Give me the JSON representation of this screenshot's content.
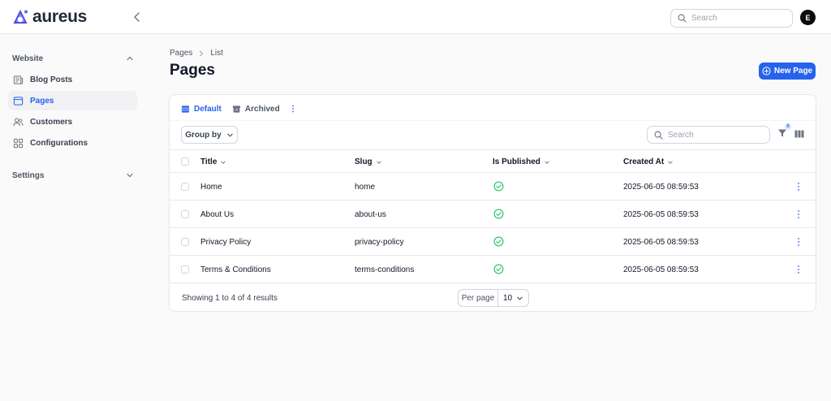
{
  "app": {
    "name": "aureus"
  },
  "topbar": {
    "search_placeholder": "Search",
    "avatar_initial": "E"
  },
  "sidebar": {
    "groups": [
      {
        "label": "Website",
        "expanded": true
      },
      {
        "label": "Settings",
        "expanded": false
      }
    ],
    "items": [
      {
        "label": "Blog Posts",
        "icon": "newspaper-icon",
        "active": false
      },
      {
        "label": "Pages",
        "icon": "browser-window-icon",
        "active": true
      },
      {
        "label": "Customers",
        "icon": "users-icon",
        "active": false
      },
      {
        "label": "Configurations",
        "icon": "grid-icon",
        "active": false
      }
    ]
  },
  "breadcrumb": [
    "Pages",
    "List"
  ],
  "page": {
    "title": "Pages",
    "new_button_label": "New Page"
  },
  "tabs": [
    {
      "label": "Default",
      "icon": "table-icon",
      "active": true
    },
    {
      "label": "Archived",
      "icon": "archive-box-icon",
      "active": false
    }
  ],
  "toolbar": {
    "group_by_label": "Group by",
    "search_placeholder": "Search",
    "filter_count": "0"
  },
  "table": {
    "columns": [
      "Title",
      "Slug",
      "Is Published",
      "Created At"
    ],
    "rows": [
      {
        "title": "Home",
        "slug": "home",
        "published": true,
        "created_at": "2025-06-05 08:59:53"
      },
      {
        "title": "About Us",
        "slug": "about-us",
        "published": true,
        "created_at": "2025-06-05 08:59:53"
      },
      {
        "title": "Privacy Policy",
        "slug": "privacy-policy",
        "published": true,
        "created_at": "2025-06-05 08:59:53"
      },
      {
        "title": "Terms & Conditions",
        "slug": "terms-conditions",
        "published": true,
        "created_at": "2025-06-05 08:59:53"
      }
    ]
  },
  "footer": {
    "showing_text": "Showing 1 to 4 of 4 results",
    "per_page_label": "Per page",
    "per_page_value": "10"
  },
  "colors": {
    "accent": "#2563eb",
    "success": "#22c55e",
    "border": "#e5e7eb"
  }
}
